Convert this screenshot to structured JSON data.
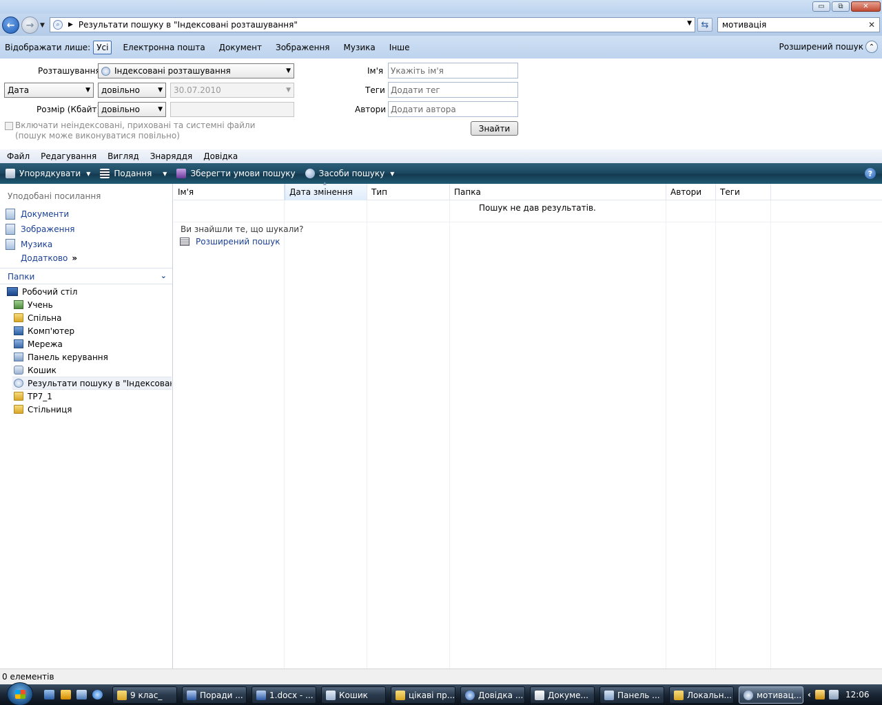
{
  "window": {
    "minimize": "▭",
    "maximize": "⧉",
    "close": "✕"
  },
  "address": {
    "back_icon": "arrow-left-icon",
    "forward_icon": "arrow-right-icon",
    "back": "←",
    "forward": "→",
    "path_text": "Результати пошуку в \"Індексовані розташування\"",
    "search_value": "мотивація",
    "clear": "✕",
    "refresh": "⇆"
  },
  "filter": {
    "label": "Відображати лише:",
    "options": [
      "Усі",
      "Електронна пошта",
      "Документ",
      "Зображення",
      "Музика",
      "Інше"
    ],
    "active": "Усі",
    "advanced_toggle": "Розширений пошук",
    "advanced_toggle_icon": "chevron-up-icon"
  },
  "advanced": {
    "location_label": "Розташування",
    "location_value": "Індексовані розташування",
    "date_field": "Дата",
    "date_op": "довільно",
    "date_value": "30.07.2010",
    "size_label": "Розмір (Кбайт)",
    "size_op": "довільно",
    "size_value": "",
    "include_label": "Включати неіндексовані, приховані та системні файли (пошук може виконуватися повільно)",
    "name_label": "Ім'я",
    "name_placeholder": "Укажіть ім'я",
    "tags_label": "Теги",
    "tags_placeholder": "Додати тег",
    "authors_label": "Автори",
    "authors_placeholder": "Додати автора",
    "find_button": "Знайти"
  },
  "menu": [
    "Файл",
    "Редагування",
    "Вигляд",
    "Знаряддя",
    "Довідка"
  ],
  "commands": {
    "organize": "Упорядкувати",
    "views": "Подання",
    "save_search": "Зберегти умови пошуку",
    "search_tools": "Засоби пошуку",
    "help": "?"
  },
  "nav": {
    "favorites_header": "Уподобані посилання",
    "favorites": [
      "Документи",
      "Зображення",
      "Музика"
    ],
    "more": "Додатково",
    "more_glyph": "»",
    "folders_header": "Папки",
    "folders_chevron": "⌄",
    "tree": [
      {
        "label": "Робочий стіл",
        "icon": "desktop-icon"
      },
      {
        "label": "Учень",
        "icon": "user-folder-icon"
      },
      {
        "label": "Спільна",
        "icon": "folder-icon"
      },
      {
        "label": "Комп'ютер",
        "icon": "computer-icon"
      },
      {
        "label": "Мережа",
        "icon": "network-icon"
      },
      {
        "label": "Панель керування",
        "icon": "control-panel-icon"
      },
      {
        "label": "Кошик",
        "icon": "recycle-bin-icon"
      },
      {
        "label": "Результати пошуку в \"Індексовані роз",
        "icon": "search-results-icon"
      },
      {
        "label": "TP7_1",
        "icon": "folder-icon"
      },
      {
        "label": "Стільниця",
        "icon": "folder-icon"
      }
    ]
  },
  "list": {
    "columns": [
      "Ім'я",
      "Дата змінення",
      "Тип",
      "Папка",
      "Автори",
      "Теги"
    ],
    "sorted_column": "Дата змінення",
    "empty_message": "Пошук не дав результатів.",
    "found_prompt": "Ви знайшли те, що шукали?",
    "advanced_link": "Розширений пошук"
  },
  "status": {
    "count": "0 елементів"
  },
  "taskbar": {
    "tasks": [
      "9 клас_",
      "Поради ...",
      "1.docx - ...",
      "Кошик",
      "цікаві пр...",
      "Довідка ...",
      "Докуме...",
      "Панель ...",
      "Локальн...",
      "мотивац..."
    ],
    "active_task": "мотивац...",
    "tray_chevron": "‹",
    "clock": "12:06"
  },
  "colors": {
    "chrome_blue": "#bcd3ee",
    "command_bar": "#1d4a63",
    "link_blue": "#1a3f95",
    "taskbar": "#1a2634"
  }
}
